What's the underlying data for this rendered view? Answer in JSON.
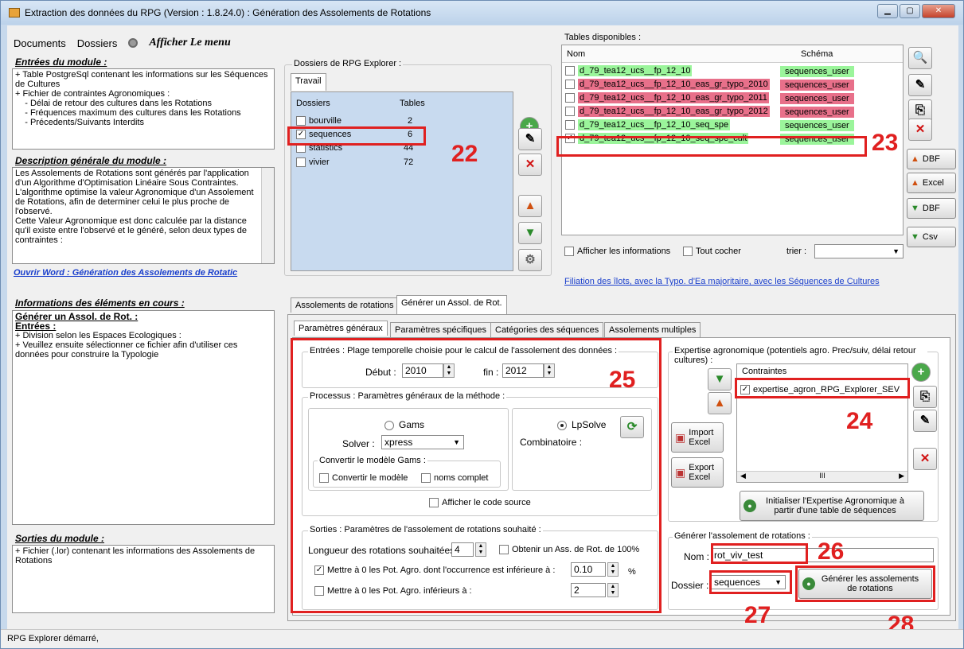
{
  "window": {
    "title": "Extraction des données du RPG (Version : 1.8.24.0) : Génération des Assolements de Rotations"
  },
  "menu": {
    "documents": "Documents",
    "dossiers": "Dossiers",
    "afficher": "Afficher Le menu"
  },
  "left": {
    "entrees_title": "Entrées du module :",
    "entrees_text": "+ Table PostgreSql contenant les informations sur les Séquences de Cultures\n+ Fichier de contraintes Agronomiques :\n    - Délai de retour des cultures dans les Rotations\n    - Fréquences maximum des cultures dans les Rotations\n    - Précedents/Suivants Interdits",
    "desc_title": "Description générale du module :",
    "desc_text": "Les Assolements de Rotations sont générés par l'application d'un Algorithme d'Optimisation Linéaire Sous Contraintes.\nL'algorithme optimise la valeur Agronomique d'un Assolement de Rotations, afin de determiner celui le plus proche de l'observé.\nCette Valeur Agronomique est donc calculée par la distance qu'il existe entre l'observé et le généré, selon deux types de contraintes :",
    "word_link": "Ouvrir Word : Génération des Assolements de Rotatic",
    "info_title": "Informations des éléments en cours :",
    "info_head": "Générer un Assol. de Rot. :",
    "info_sub": "Entrées :",
    "info_text": "+ Division selon les Espaces Ecologiques :\n+ Veuillez ensuite sélectionner ce fichier afin d'utiliser ces données pour construire la Typologie",
    "sorties_title": "Sorties du module :",
    "sorties_text": "+ Fichier (.lor) contenant les informations des Assolements de Rotations"
  },
  "dossiers": {
    "group_title": "Dossiers de RPG Explorer :",
    "tab": "Travail",
    "col_dossiers": "Dossiers",
    "col_tables": "Tables",
    "rows": [
      {
        "name": "bourville",
        "count": "2",
        "checked": false
      },
      {
        "name": "sequences",
        "count": "6",
        "checked": true
      },
      {
        "name": "statistics",
        "count": "44",
        "checked": false
      },
      {
        "name": "vivier",
        "count": "72",
        "checked": false
      }
    ]
  },
  "tables": {
    "title": "Tables disponibles :",
    "col_nom": "Nom",
    "col_schema": "Schéma",
    "rows": [
      {
        "name": "d_79_tea12_ucs__fp_12_10",
        "schema": "sequences_user",
        "color": "green",
        "checked": false
      },
      {
        "name": "d_79_tea12_ucs__fp_12_10_eas_gr_typo_2010",
        "schema": "sequences_user",
        "color": "pink",
        "checked": false
      },
      {
        "name": "d_79_tea12_ucs__fp_12_10_eas_gr_typo_2011",
        "schema": "sequences_user",
        "color": "pink",
        "checked": false
      },
      {
        "name": "d_79_tea12_ucs__fp_12_10_eas_gr_typo_2012",
        "schema": "sequences_user",
        "color": "pink",
        "checked": false
      },
      {
        "name": "d_79_tea12_ucs__fp_12_10_seq_spe",
        "schema": "sequences_user",
        "color": "green",
        "checked": false
      },
      {
        "name": "d_79_tea12_ucs__fp_12_10_seq_spe_cult",
        "schema": "sequences_user",
        "color": "green",
        "checked": true
      }
    ],
    "afficher_info": "Afficher les informations",
    "tout_cocher": "Tout cocher",
    "trier": "trier :",
    "filiation_link": "Filiation des îlots, avec la Typo. d'Ea majoritaire, avec les Séquences de Cultures",
    "btn_dbf": "DBF",
    "btn_excel": "Excel",
    "btn_dbf2": "DBF",
    "btn_csv": "Csv"
  },
  "main_tabs": {
    "t1": "Assolements de rotations",
    "t2": "Générer un Assol. de Rot."
  },
  "sub_tabs": {
    "t1": "Paramètres généraux",
    "t2": "Paramètres spécifiques",
    "t3": "Catégories des séquences",
    "t4": "Assolements multiples"
  },
  "entrees": {
    "title": "Entrées : Plage temporelle choisie pour le calcul de l'assolement des données :",
    "debut_label": "Début :",
    "debut": "2010",
    "fin_label": "fin :",
    "fin": "2012"
  },
  "processus": {
    "title": "Processus : Paramètres généraux de la méthode :",
    "gams": "Gams",
    "lpsolve": "LpSolve",
    "solver_label": "Solver :",
    "solver": "xpress",
    "combinatoire": "Combinatoire :",
    "convert_title": "Convertir le modèle Gams :",
    "convertir": "Convertir le modèle",
    "noms_complet": "noms complet",
    "afficher_code": "Afficher le code source"
  },
  "sorties": {
    "title": "Sorties : Paramètres de l'assolement de rotations souhaité :",
    "longueur_label": "Longueur des rotations souhaitées :",
    "longueur": "4",
    "obtenir": "Obtenir un Ass. de Rot. de 100%",
    "mettre1": "Mettre à 0 les Pot. Agro. dont l'occurrence est inférieure à :",
    "mettre1_val": "0.10",
    "pct": "%",
    "mettre2": "Mettre à 0 les Pot. Agro. inférieurs à :",
    "mettre2_val": "2"
  },
  "expertise": {
    "title": "Expertise agronomique (potentiels agro. Prec/suiv, délai retour cultures) :",
    "contraintes": "Contraintes",
    "item": "expertise_agron_RPG_Explorer_SEV",
    "import_excel": "Import Excel",
    "export_excel": "Export Excel",
    "scroll": "III",
    "init_btn": "Initialiser l'Expertise Agronomique à partir d'une table de séquences"
  },
  "generer": {
    "title": "Générer l'assolement de rotations :",
    "nom_label": "Nom :",
    "nom": "rot_viv_test",
    "dossier_label": "Dossier :",
    "dossier": "sequences",
    "btn": "Générer les assolements de rotations"
  },
  "annotations": {
    "n22": "22",
    "n23": "23",
    "n24": "24",
    "n25": "25",
    "n26": "26",
    "n27": "27",
    "n28": "28"
  },
  "status": "RPG Explorer démarré,"
}
